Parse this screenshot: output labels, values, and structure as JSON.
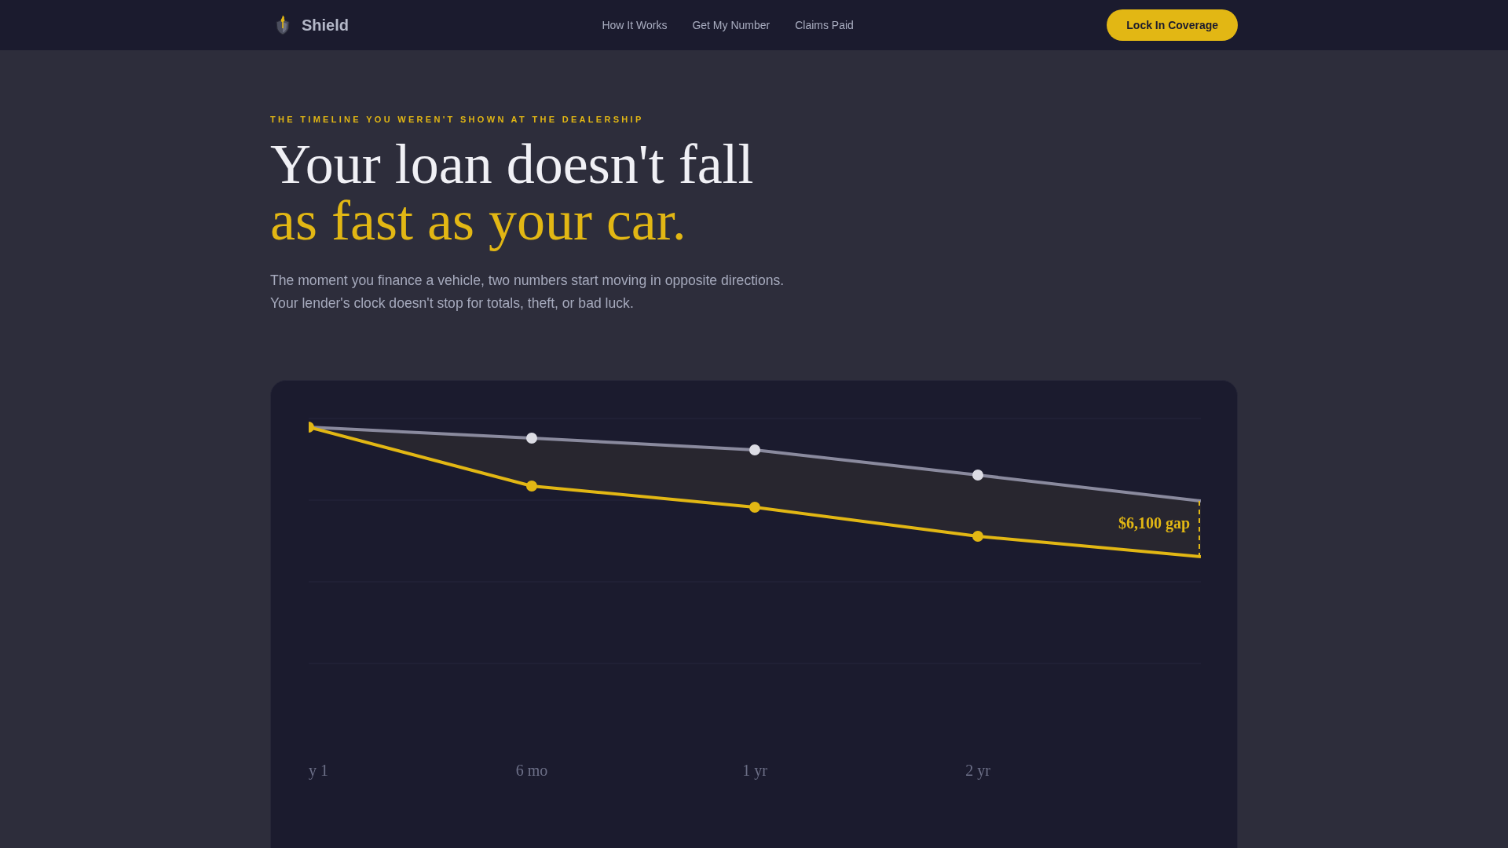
{
  "nav": {
    "brand": "Shield",
    "links": [
      "How It Works",
      "Get My Number",
      "Claims Paid"
    ],
    "cta": "Lock In Coverage"
  },
  "hero": {
    "eyebrow": "THE TIMELINE YOU WEREN'T SHOWN AT THE DEALERSHIP",
    "title_line_1": "Your loan doesn't fall",
    "title_line_2": "as fast as your car.",
    "body": "The moment you finance a vehicle, two numbers start moving in opposite directions. Your lender's clock doesn't stop for totals, theft, or bad luck."
  },
  "chart": {
    "x_labels": [
      "y 1",
      "6 mo",
      "1 yr",
      "2 yr"
    ],
    "gap_label": "$6,100 gap"
  }
}
